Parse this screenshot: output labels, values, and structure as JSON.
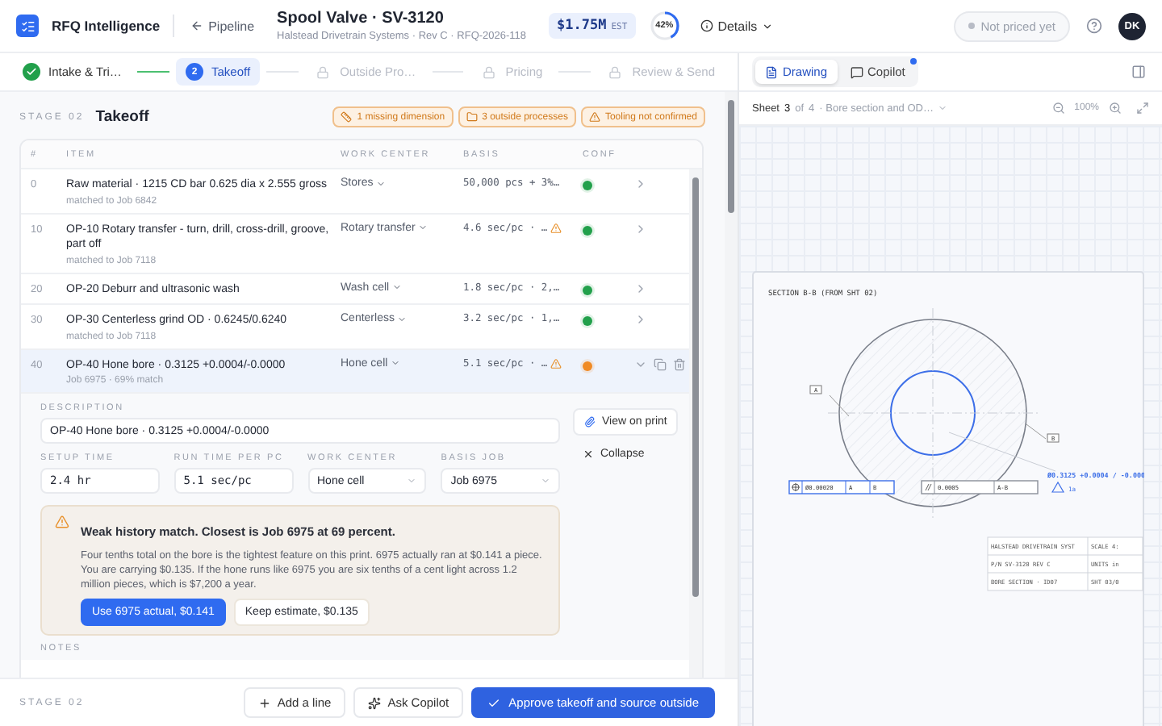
{
  "app": {
    "name": "RFQ Intelligence"
  },
  "nav": {
    "back": "Pipeline"
  },
  "quote": {
    "title": "Spool Valve · SV-3120",
    "subtitle": "Halstead Drivetrain Systems · Rev C · RFQ-2026-118",
    "estimate": "$1.75M",
    "estimate_tag": "EST",
    "progress": {
      "level": 0.42,
      "label": "42%"
    },
    "details": "Details"
  },
  "status": {
    "label": "Not priced yet"
  },
  "user": {
    "initials": "DK"
  },
  "steps": [
    {
      "label": "Intake & Tri…",
      "done": true,
      "selected": false
    },
    {
      "label": "Takeoff",
      "number": "2",
      "done": false,
      "selected": true
    },
    {
      "label": "Outside Pro…",
      "done": false,
      "selected": false
    },
    {
      "label": "Pricing",
      "done": false,
      "selected": false
    },
    {
      "label": "Review & Send",
      "done": false,
      "selected": false
    }
  ],
  "viewer_tabs": [
    {
      "label": "Drawing",
      "kind": "drawing",
      "selected": true,
      "unread": false
    },
    {
      "label": "Copilot",
      "kind": "copilot",
      "selected": false,
      "unread": true
    }
  ],
  "stage": {
    "tag": "STAGE 02",
    "title": "Takeoff",
    "flags": [
      {
        "kind": "dimension",
        "label": "1 missing dimension"
      },
      {
        "kind": "outside",
        "label": "3 outside processes"
      },
      {
        "kind": "tooling",
        "label": "Tooling not confirmed"
      }
    ]
  },
  "table": {
    "columns": [
      "#",
      "ITEM",
      "WORK CENTER",
      "BASIS",
      "CONF"
    ],
    "rows": [
      {
        "num": "0",
        "item": "Raw material · 1215 CD bar 0.625 dia x 2.555 gross",
        "match": "matched to Job 6842",
        "work_center": "Stores",
        "basis": "50,000 pcs + 3%…",
        "warning": false,
        "color": "#22a04b",
        "expanded": false
      },
      {
        "num": "10",
        "item": "OP-10 Rotary transfer - turn, drill, cross-drill, groove, part off",
        "match": "matched to Job 7118",
        "work_center": "Rotary transfer",
        "basis": "4.6 sec/pc · …",
        "warning": true,
        "color": "#22a04b",
        "expanded": false
      },
      {
        "num": "20",
        "item": "OP-20 Deburr and ultrasonic wash",
        "work_center": "Wash cell",
        "basis": "1.8 sec/pc · 2,…",
        "warning": false,
        "color": "#22a04b",
        "expanded": false
      },
      {
        "num": "30",
        "item": "OP-30 Centerless grind OD · 0.6245/0.6240",
        "match": "matched to Job 7118",
        "work_center": "Centerless",
        "basis": "3.2 sec/pc · 1,…",
        "warning": false,
        "color": "#22a04b",
        "expanded": false
      },
      {
        "num": "40",
        "item": "OP-40 Hone bore · 0.3125 +0.0004/-0.0000",
        "match": "Job 6975 · 69% match",
        "work_center": "Hone cell",
        "basis": "5.1 sec/pc · …",
        "warning": true,
        "color": "#f08a24",
        "expanded": true
      }
    ]
  },
  "detail": {
    "description_label": "DESCRIPTION",
    "description": "OP-40 Hone bore · 0.3125 +0.0004/-0.0000",
    "view_on_print": "View on print",
    "collapse": "Collapse",
    "fields": [
      {
        "kind": "text",
        "label": "SETUP TIME",
        "value": "2.4 hr"
      },
      {
        "kind": "text",
        "label": "RUN TIME PER PC",
        "value": "5.1 sec/pc"
      },
      {
        "kind": "select",
        "label": "WORK CENTER",
        "value": "Hone cell"
      },
      {
        "kind": "select",
        "label": "BASIS JOB",
        "value": "Job 6975"
      }
    ],
    "alert": {
      "title": "Weak history match. Closest is Job 6975 at 69 percent.",
      "body": "Four tenths total on the bore is the tightest feature on this print. 6975 actually ran at $0.141 a piece. You are carrying $0.135. If the hone runs like 6975 you are six tenths of a cent light across 1.2 million pieces, which is $7,200 a year.",
      "actions": [
        {
          "label": "Use 6975 actual, $0.141",
          "primary": true
        },
        {
          "label": "Keep estimate, $0.135",
          "primary": false
        }
      ]
    },
    "notes_label": "NOTES"
  },
  "footer": {
    "stage": "STAGE 02",
    "add": "Add a line",
    "ask": "Ask Copilot",
    "approve": "Approve takeoff and source outside"
  },
  "sheet": {
    "prefix": "Sheet",
    "number": "3",
    "of": "of",
    "total": "4",
    "title": "· Bore section and OD…",
    "zoom": "100%"
  },
  "drawing": {
    "section_title": "SECTION B-B (FROM SHT 02)",
    "datums": [
      "A",
      "B"
    ],
    "frames": [
      {
        "kind": "position",
        "cells": [
          "Ø0.00020",
          "A",
          "B"
        ]
      },
      {
        "kind": "parallel",
        "cells": [
          "0.0005",
          "A-B"
        ]
      }
    ],
    "dimension": "Ø0.3125 +0.0004 / -0.000",
    "note": "1a",
    "title_block": [
      {
        "left": "HALSTEAD DRIVETRAIN SYST",
        "right": "SCALE 4:"
      },
      {
        "left": "P/N SV-3120 REV C",
        "right": "UNITS in"
      },
      {
        "left": "BORE SECTION · ID07",
        "right": "SHT 03/0"
      }
    ]
  }
}
